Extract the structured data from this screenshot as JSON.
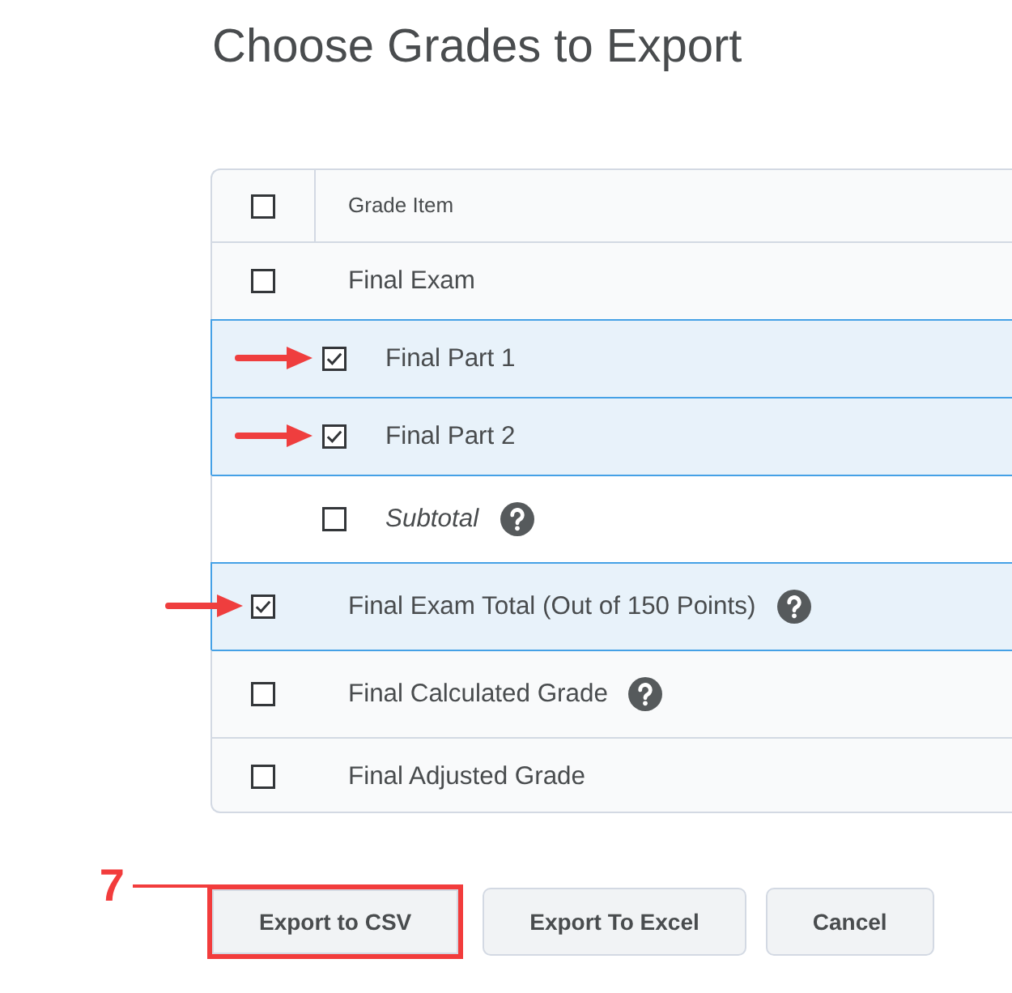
{
  "page": {
    "title": "Choose Grades to Export"
  },
  "table": {
    "header": {
      "label": "Grade Item",
      "checked": false
    },
    "rows": [
      {
        "label": "Final Exam",
        "kind": "item",
        "checked": false,
        "arrow": false,
        "help": false,
        "children": [
          {
            "label": "Final Part 1",
            "kind": "item",
            "checked": true,
            "arrow": true,
            "help": false
          },
          {
            "label": "Final Part 2",
            "kind": "item",
            "checked": true,
            "arrow": true,
            "help": false
          },
          {
            "label": "Subtotal",
            "kind": "subtotal",
            "checked": false,
            "arrow": false,
            "help": true
          }
        ]
      },
      {
        "label": "Final Exam Total (Out of 150 Points)",
        "kind": "item",
        "checked": true,
        "arrow": true,
        "help": true
      },
      {
        "label": "Final Calculated Grade",
        "kind": "item",
        "checked": false,
        "arrow": false,
        "help": true
      },
      {
        "label": "Final Adjusted Grade",
        "kind": "item",
        "checked": false,
        "arrow": false,
        "help": false
      }
    ]
  },
  "buttons": [
    {
      "label": "Export to CSV",
      "highlighted": true,
      "callout": "7"
    },
    {
      "label": "Export To Excel",
      "highlighted": false
    },
    {
      "label": "Cancel",
      "highlighted": false
    }
  ]
}
